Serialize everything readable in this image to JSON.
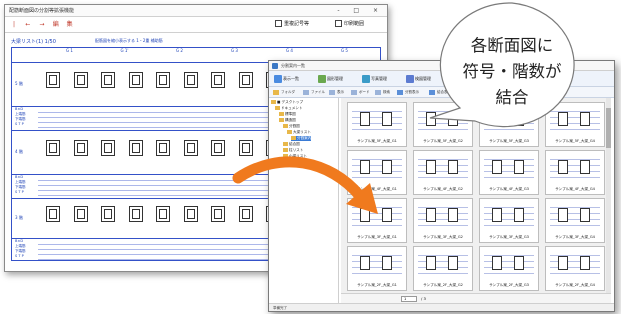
{
  "back_window": {
    "title": "配筋断面図の分割等拡張機能",
    "win_buttons": "- □ ×",
    "toolbar_icons": [
      "|",
      "←",
      "→",
      "編",
      "集"
    ],
    "check_1": "重複記号等",
    "check_2": "印刷範囲",
    "scale_label": "大梁リスト(1) 1/50",
    "scale_note": "配筋図を縮小表示する 1・2重  補助筋",
    "columns": [
      "G 1",
      "G 1'",
      "G 2",
      "G 3",
      "G 4",
      "G 5"
    ],
    "floors": [
      "5 階",
      "4 階",
      "3 階"
    ],
    "spec_headers": [
      "B×D",
      "上端筋",
      "下端筋",
      "S T P"
    ]
  },
  "front_window": {
    "title": "分割案内一覧",
    "ribbon": [
      "表示一覧",
      "図形管理",
      "写真管理",
      "検図管理",
      "リスト管理"
    ],
    "ribbon2": [
      "フォルダ",
      "ファイル",
      "表示",
      "ボード",
      "検索",
      "分割表示",
      "結合表示",
      "拡大"
    ],
    "tree": [
      "■ デスクトップ",
      "ドキュメント",
      "標準図",
      "構造図",
      "分割図",
      "大梁リスト",
      "分割案内",
      "結合図",
      "柱リスト",
      "小梁リスト"
    ],
    "thumbs": [
      "サンプル案_5F_大梁_G1",
      "サンプル案_5F_大梁_G2",
      "サンプル案_5F_大梁_G3",
      "サンプル案_5F_大梁_G4",
      "サンプル案_4F_大梁_G1",
      "サンプル案_4F_大梁_G2",
      "サンプル案_4F_大梁_G3",
      "サンプル案_4F_大梁_G4",
      "サンプル案_3F_大梁_G1",
      "サンプル案_3F_大梁_G2",
      "サンプル案_3F_大梁_G3",
      "サンプル案_3F_大梁_G4",
      "サンプル案_2F_大梁_G1",
      "サンプル案_2F_大梁_G2",
      "サンプル案_2F_大梁_G3",
      "サンプル案_2F_大梁_G4"
    ],
    "pager_page": "1",
    "pager_total": "/ 3",
    "status": "準備完了"
  },
  "callout": {
    "line1": "各断面図に",
    "line2": "符号・階数が",
    "line3": "結合"
  },
  "colors": {
    "arrow": "#f07a1e",
    "line_blue": "#3451c8",
    "bubble_stroke": "#7a7a7a"
  }
}
